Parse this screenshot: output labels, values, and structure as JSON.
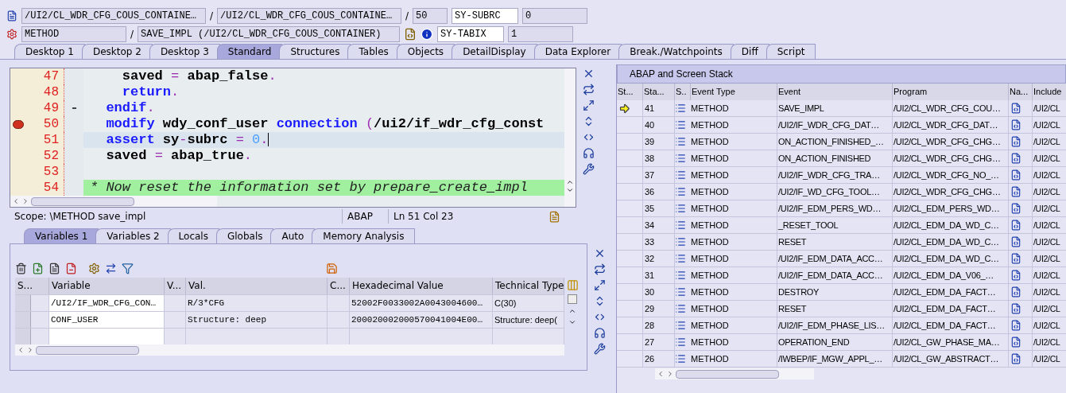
{
  "context": {
    "program": "/UI2/CL_WDR_CFG_COUS_CONTAINE…",
    "separator_1": "/",
    "include": "/UI2/CL_WDR_CFG_COUS_CONTAINE…",
    "separator_2": "/",
    "line": "50",
    "event_type": "METHOD",
    "separator_3": "/",
    "event": "SAVE_IMPL (/UI2/CL_WDR_CFG_COUS_CONTAINER)"
  },
  "system_fields": [
    {
      "name": "SY-SUBRC",
      "value": "0"
    },
    {
      "name": "SY-TABIX",
      "value": "1"
    }
  ],
  "tabs": [
    {
      "label": "Desktop 1",
      "selected": false
    },
    {
      "label": "Desktop 2",
      "selected": false
    },
    {
      "label": "Desktop 3",
      "selected": false
    },
    {
      "label": "Standard",
      "selected": true
    },
    {
      "label": "Structures",
      "selected": false
    },
    {
      "label": "Tables",
      "selected": false
    },
    {
      "label": "Objects",
      "selected": false
    },
    {
      "label": "DetailDisplay",
      "selected": false
    },
    {
      "label": "Data Explorer",
      "selected": false
    },
    {
      "label": "Break./Watchpoints",
      "selected": false
    },
    {
      "label": "Diff",
      "selected": false
    },
    {
      "label": "Script",
      "selected": false
    }
  ],
  "editor": {
    "lines": [
      {
        "number": "47",
        "breakpoint": false,
        "current": false,
        "fold": false,
        "comment": false,
        "tokens": [
          {
            "kind": "ident",
            "text": "    saved "
          },
          {
            "kind": "op",
            "text": "= "
          },
          {
            "kind": "ident",
            "text": "abap_false"
          },
          {
            "kind": "op",
            "text": "."
          }
        ]
      },
      {
        "number": "48",
        "breakpoint": false,
        "current": false,
        "fold": false,
        "comment": false,
        "tokens": [
          {
            "kind": "kw",
            "text": "    return"
          },
          {
            "kind": "op",
            "text": "."
          }
        ]
      },
      {
        "number": "49",
        "breakpoint": false,
        "current": false,
        "fold": true,
        "comment": false,
        "tokens": [
          {
            "kind": "kw",
            "text": "  endif"
          },
          {
            "kind": "op",
            "text": "."
          }
        ]
      },
      {
        "number": "50",
        "breakpoint": true,
        "current": false,
        "fold": false,
        "comment": false,
        "tokens": [
          {
            "kind": "kw",
            "text": "  modify "
          },
          {
            "kind": "ident",
            "text": "wdy_conf_user "
          },
          {
            "kind": "kw",
            "text": "connection "
          },
          {
            "kind": "op",
            "text": "("
          },
          {
            "kind": "ident",
            "text": "/ui2/if_wdr_cfg_const"
          }
        ]
      },
      {
        "number": "51",
        "breakpoint": false,
        "current": true,
        "fold": false,
        "comment": false,
        "tokens": [
          {
            "kind": "kw",
            "text": "  assert "
          },
          {
            "kind": "ident",
            "text": "sy"
          },
          {
            "kind": "op",
            "text": "-"
          },
          {
            "kind": "ident",
            "text": "subrc "
          },
          {
            "kind": "op",
            "text": "= "
          },
          {
            "kind": "num",
            "text": "0"
          },
          {
            "kind": "op",
            "text": "."
          }
        ]
      },
      {
        "number": "52",
        "breakpoint": false,
        "current": false,
        "fold": false,
        "comment": false,
        "tokens": [
          {
            "kind": "ident",
            "text": "  saved "
          },
          {
            "kind": "op",
            "text": "= "
          },
          {
            "kind": "ident",
            "text": "abap_true"
          },
          {
            "kind": "op",
            "text": "."
          }
        ]
      },
      {
        "number": "53",
        "breakpoint": false,
        "current": false,
        "fold": false,
        "comment": false
      },
      {
        "number": "54",
        "breakpoint": false,
        "current": false,
        "fold": false,
        "comment": true,
        "tokens": [
          {
            "kind": "comment",
            "text": "* Now reset the information set by prepare_create_impl"
          }
        ]
      }
    ],
    "status": {
      "scope": "Scope: \\METHOD save_impl",
      "language": "ABAP",
      "position": "Ln 51 Col 23"
    }
  },
  "variables": {
    "tabs": [
      {
        "label": "Variables 1",
        "selected": true
      },
      {
        "label": "Variables 2",
        "selected": false
      },
      {
        "label": "Locals",
        "selected": false
      },
      {
        "label": "Globals",
        "selected": false
      },
      {
        "label": "Auto",
        "selected": false
      },
      {
        "label": "Memory Analysis",
        "selected": false
      }
    ],
    "columns": [
      "S...",
      "Variable",
      "V...",
      "Val.",
      "C...",
      "Hexadecimal Value",
      "Technical Type"
    ],
    "rows": [
      {
        "variable": "/UI2/IF_WDR_CFG_CON…",
        "value": "R/3*CFG",
        "hex": "52002F0033002A0043004600…",
        "type": "C(30)"
      },
      {
        "variable": "CONF_USER",
        "value": "Structure: deep",
        "hex": "200020002000570041004E00…",
        "type": "Structure: deep("
      }
    ]
  },
  "stack": {
    "title": "ABAP and Screen Stack",
    "columns": [
      "St...",
      "Sta...",
      "S..",
      "Event Type",
      "Event",
      "Program",
      "Na...",
      "Include"
    ],
    "rows": [
      {
        "current": true,
        "number": "41",
        "event_type": "METHOD",
        "event": "SAVE_IMPL",
        "program": "/UI2/CL_WDR_CFG_COU…",
        "include": "/UI2/CL"
      },
      {
        "current": false,
        "number": "40",
        "event_type": "METHOD",
        "event": "/UI2/IF_WDR_CFG_DAT…",
        "program": "/UI2/CL_WDR_CFG_DAT…",
        "include": "/UI2/CL"
      },
      {
        "current": false,
        "number": "39",
        "event_type": "METHOD",
        "event": "ON_ACTION_FINISHED_…",
        "program": "/UI2/CL_WDR_CFG_CHG…",
        "include": "/UI2/CL"
      },
      {
        "current": false,
        "number": "38",
        "event_type": "METHOD",
        "event": "ON_ACTION_FINISHED",
        "program": "/UI2/CL_WDR_CFG_CHG…",
        "include": "/UI2/CL"
      },
      {
        "current": false,
        "number": "37",
        "event_type": "METHOD",
        "event": "/UI2/IF_WDR_CFG_TRA…",
        "program": "/UI2/CL_WDR_CFG_NO_…",
        "include": "/UI2/CL"
      },
      {
        "current": false,
        "number": "36",
        "event_type": "METHOD",
        "event": "/UI2/IF_WD_CFG_TOOL…",
        "program": "/UI2/CL_WDR_CFG_CHG…",
        "include": "/UI2/CL"
      },
      {
        "current": false,
        "number": "35",
        "event_type": "METHOD",
        "event": "/UI2/IF_EDM_PERS_WD…",
        "program": "/UI2/CL_EDM_PERS_WD…",
        "include": "/UI2/CL"
      },
      {
        "current": false,
        "number": "34",
        "event_type": "METHOD",
        "event": "_RESET_TOOL",
        "program": "/UI2/CL_EDM_DA_WD_C…",
        "include": "/UI2/CL"
      },
      {
        "current": false,
        "number": "33",
        "event_type": "METHOD",
        "event": "RESET",
        "program": "/UI2/CL_EDM_DA_WD_C…",
        "include": "/UI2/CL"
      },
      {
        "current": false,
        "number": "32",
        "event_type": "METHOD",
        "event": "/UI2/IF_EDM_DATA_ACC…",
        "program": "/UI2/CL_EDM_DA_WD_C…",
        "include": "/UI2/CL"
      },
      {
        "current": false,
        "number": "31",
        "event_type": "METHOD",
        "event": "/UI2/IF_EDM_DATA_ACC…",
        "program": "/UI2/CL_EDM_DA_V06_…",
        "include": "/UI2/CL"
      },
      {
        "current": false,
        "number": "30",
        "event_type": "METHOD",
        "event": "DESTROY",
        "program": "/UI2/CL_EDM_DA_FACT…",
        "include": "/UI2/CL"
      },
      {
        "current": false,
        "number": "29",
        "event_type": "METHOD",
        "event": "RESET",
        "program": "/UI2/CL_EDM_DA_FACT…",
        "include": "/UI2/CL"
      },
      {
        "current": false,
        "number": "28",
        "event_type": "METHOD",
        "event": "/UI2/IF_EDM_PHASE_LIS…",
        "program": "/UI2/CL_EDM_DA_FACT…",
        "include": "/UI2/CL"
      },
      {
        "current": false,
        "number": "27",
        "event_type": "METHOD",
        "event": "OPERATION_END",
        "program": "/UI2/CL_GW_PHASE_MA…",
        "include": "/UI2/CL"
      },
      {
        "current": false,
        "number": "26",
        "event_type": "METHOD",
        "event": "/IWBEP/IF_MGW_APPL_…",
        "program": "/UI2/CL_GW_ABSTRACT…",
        "include": "/UI2/CL"
      }
    ]
  }
}
